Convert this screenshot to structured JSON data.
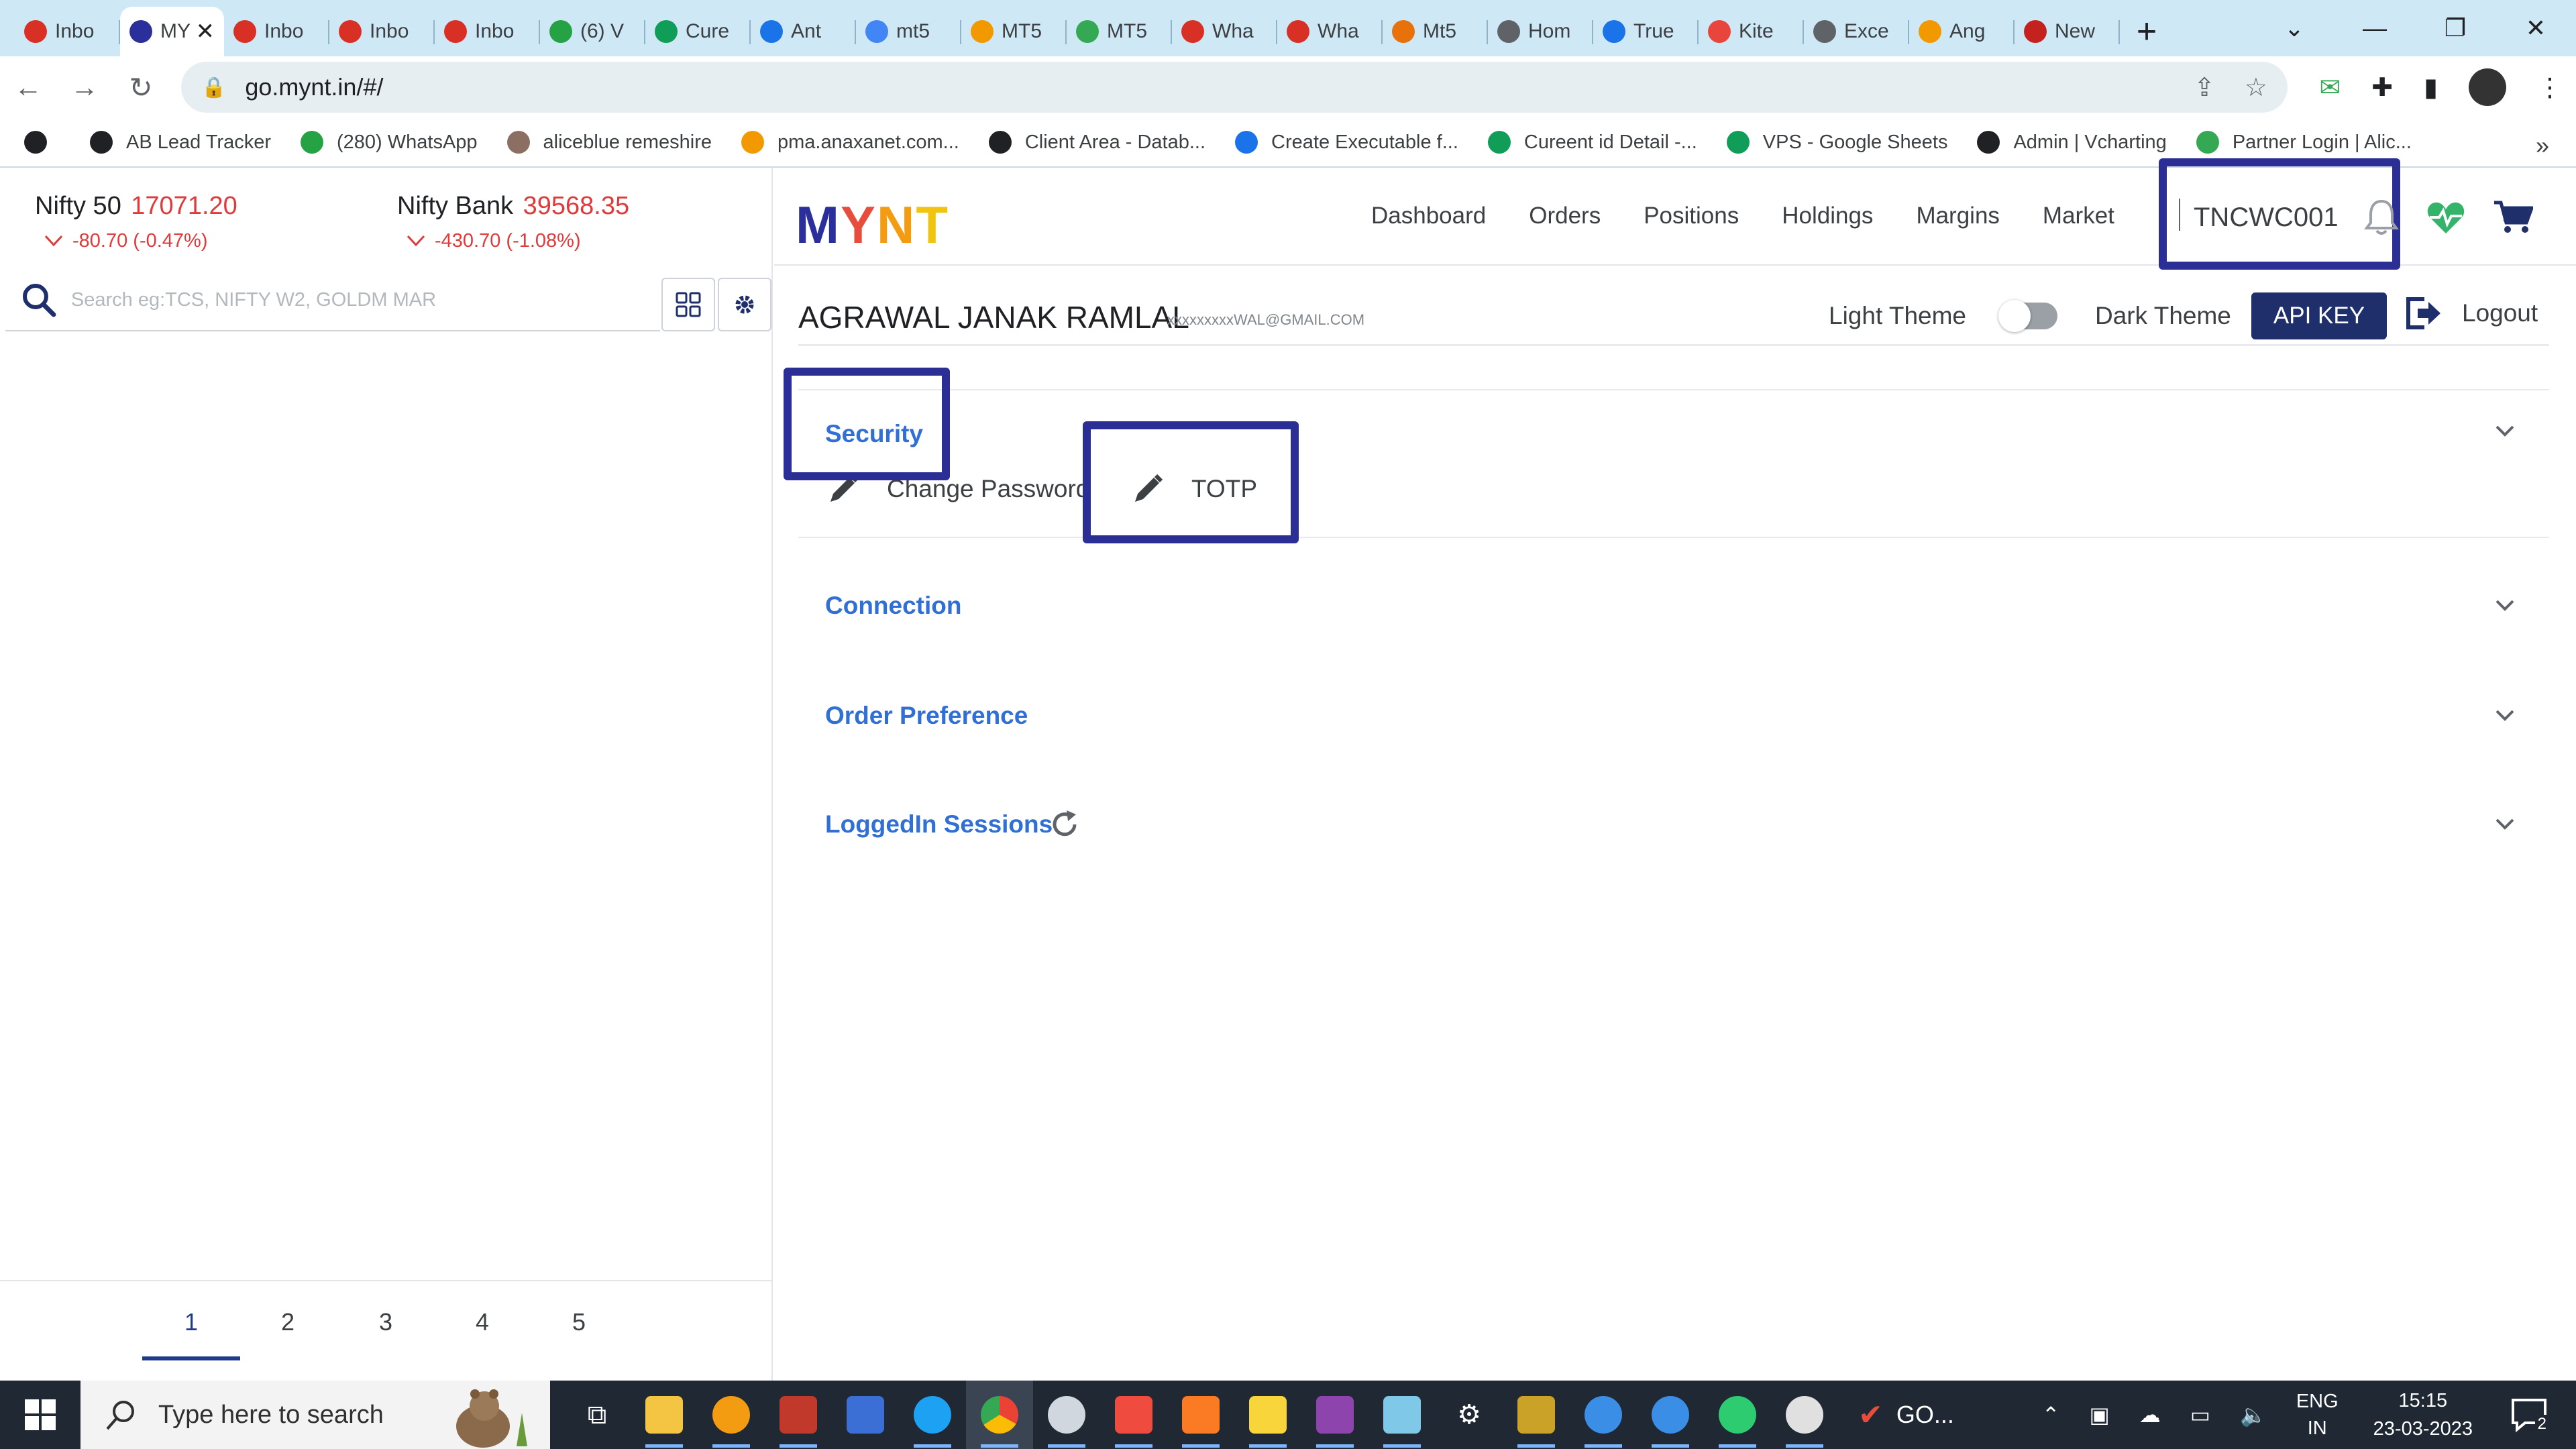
{
  "browser": {
    "tabs": [
      {
        "label": "Inbo",
        "icon": "gmail-icon",
        "color": "#d93025"
      },
      {
        "label": "MYNT",
        "icon": "mynt-icon",
        "color": "#2a2f9c",
        "active": true
      },
      {
        "label": "Inbo",
        "icon": "gmail-icon",
        "color": "#d93025"
      },
      {
        "label": "Inbo",
        "icon": "gmail-icon",
        "color": "#d93025"
      },
      {
        "label": "Inbo",
        "icon": "gmail-icon",
        "color": "#d93025"
      },
      {
        "label": "(6) V",
        "icon": "whatsapp-icon",
        "color": "#25a244"
      },
      {
        "label": "Cure",
        "icon": "sheets-icon",
        "color": "#0f9d58"
      },
      {
        "label": "Ant",
        "icon": "antivirus-icon",
        "color": "#1a73e8"
      },
      {
        "label": "mt5",
        "icon": "google-icon",
        "color": "#4285f4"
      },
      {
        "label": "MT5",
        "icon": "warning-icon",
        "color": "#f29900"
      },
      {
        "label": "MT5",
        "icon": "metaquotes-icon",
        "color": "#34a853"
      },
      {
        "label": "Wha",
        "icon": "alert-icon",
        "color": "#d93025"
      },
      {
        "label": "Wha",
        "icon": "alert-icon",
        "color": "#d93025"
      },
      {
        "label": "Mt5",
        "icon": "coin-icon",
        "color": "#e8710a"
      },
      {
        "label": "Hom",
        "icon": "m-icon",
        "color": "#5f6368"
      },
      {
        "label": "True",
        "icon": "tc-icon",
        "color": "#1a73e8"
      },
      {
        "label": "Kite",
        "icon": "kite-icon",
        "color": "#e8453c"
      },
      {
        "label": "Exce",
        "icon": "globe-icon",
        "color": "#5f6368"
      },
      {
        "label": "Ang",
        "icon": "angel-icon",
        "color": "#f29900"
      },
      {
        "label": "New",
        "icon": "toi-icon",
        "color": "#c5221f"
      }
    ],
    "tab_close": "✕",
    "new_tab": "+",
    "address": "go.mynt.in/#/",
    "bookmarks": [
      {
        "label": "AB Lead Tracker",
        "icon": "globe-icon",
        "color": "#202124"
      },
      {
        "label": "(280) WhatsApp",
        "icon": "whatsapp-icon",
        "color": "#25a244"
      },
      {
        "label": "aliceblue remeshire",
        "icon": "image-icon",
        "color": "#8d6e63"
      },
      {
        "label": "pma.anaxanet.com...",
        "icon": "pma-icon",
        "color": "#f29900"
      },
      {
        "label": "Client Area - Datab...",
        "icon": "globe-icon",
        "color": "#202124"
      },
      {
        "label": "Create Executable f...",
        "icon": "fish-icon",
        "color": "#1a73e8"
      },
      {
        "label": "Cureent id Detail -...",
        "icon": "sheets-icon",
        "color": "#0f9d58"
      },
      {
        "label": "VPS - Google Sheets",
        "icon": "sheets-icon",
        "color": "#0f9d58"
      },
      {
        "label": "Admin | Vcharting",
        "icon": "globe-icon",
        "color": "#202124"
      },
      {
        "label": "Partner Login | Alic...",
        "icon": "aliceblue-icon",
        "color": "#34a853"
      }
    ],
    "bookmarks_more": "»"
  },
  "left": {
    "indices": [
      {
        "name": "Nifty 50",
        "value": "17071.20",
        "change": "-80.70 (-0.47%)"
      },
      {
        "name": "Nifty Bank",
        "value": "39568.35",
        "change": "-430.70 (-1.08%)"
      }
    ],
    "search_placeholder": "Search eg:TCS, NIFTY W2, GOLDM MAR",
    "pages": [
      "1",
      "2",
      "3",
      "4",
      "5"
    ],
    "active_page": "1"
  },
  "header": {
    "logo": {
      "m": "M",
      "y": "Y",
      "n": "N",
      "t": "T"
    },
    "nav": [
      "Dashboard",
      "Orders",
      "Positions",
      "Holdings",
      "Margins",
      "Market"
    ],
    "client_id": "TNCWC001"
  },
  "profile": {
    "name": "AGRAWAL JANAK RAMLAL",
    "email": "xxxxxxxxxWAL@GMAIL.COM",
    "light_theme": "Light Theme",
    "dark_theme": "Dark Theme",
    "api_key": "API KEY",
    "logout": "Logout"
  },
  "sections": {
    "security": {
      "title": "Security",
      "change_password": "Change Password",
      "totp": "TOTP"
    },
    "connection": {
      "title": "Connection"
    },
    "order_preference": {
      "title": "Order Preference"
    },
    "loggedin_sessions": {
      "title": "LoggedIn Sessions"
    }
  },
  "colors": {
    "accent_link": "#2f6fd6",
    "highlight_box": "#2b2e94",
    "negative": "#e03a3a",
    "api_key_bg": "#1e2f6b"
  },
  "taskbar": {
    "search_placeholder": "Type here to search",
    "running_app": "GO...",
    "lang": "ENG",
    "region": "IN",
    "time": "15:15",
    "date": "23-03-2023",
    "notifications": "2"
  }
}
